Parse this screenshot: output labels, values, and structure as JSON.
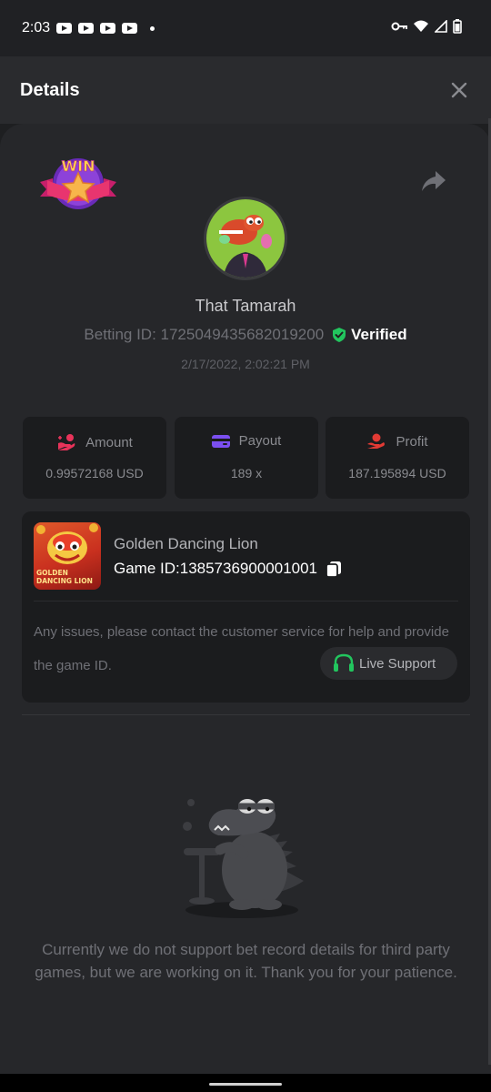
{
  "status_bar": {
    "time": "2:03",
    "notification_icons": [
      "youtube-icon",
      "youtube-icon",
      "youtube-icon",
      "youtube-icon"
    ],
    "system_icons": [
      "key-icon",
      "wifi-icon",
      "signal-icon",
      "battery-icon"
    ]
  },
  "header": {
    "title": "Details",
    "close_icon": "close-icon"
  },
  "bet": {
    "badge": "WIN",
    "user_name": "That Tamarah",
    "betting_id": "Betting ID: 1725049435682019200",
    "verified_label": "Verified",
    "date": "2/17/2022, 2:02:21 PM"
  },
  "stats": [
    {
      "icon": "amount-icon",
      "label": "Amount",
      "value": "0.99572168 USD",
      "color": "#e8335a"
    },
    {
      "icon": "payout-icon",
      "label": "Payout",
      "value": "189 x",
      "color": "#7b4ff0"
    },
    {
      "icon": "profit-icon",
      "label": "Profit",
      "value": "187.195894 USD",
      "color": "#e23a34"
    }
  ],
  "game": {
    "name": "Golden Dancing Lion",
    "game_id": "Game ID:1385736900001001",
    "thumb_text_1": "GOLDEN",
    "thumb_text_2": "DANCING LION",
    "help_text": "Any issues, please contact the customer service for help and provide the game ID.",
    "live_support_label": "Live Support"
  },
  "notice": "Currently we do not support bet record details for third party games, but we are working on it. Thank you for your patience.",
  "colors": {
    "accent_green": "#22c55e",
    "background": "#26272a",
    "card": "#1b1c1e"
  }
}
